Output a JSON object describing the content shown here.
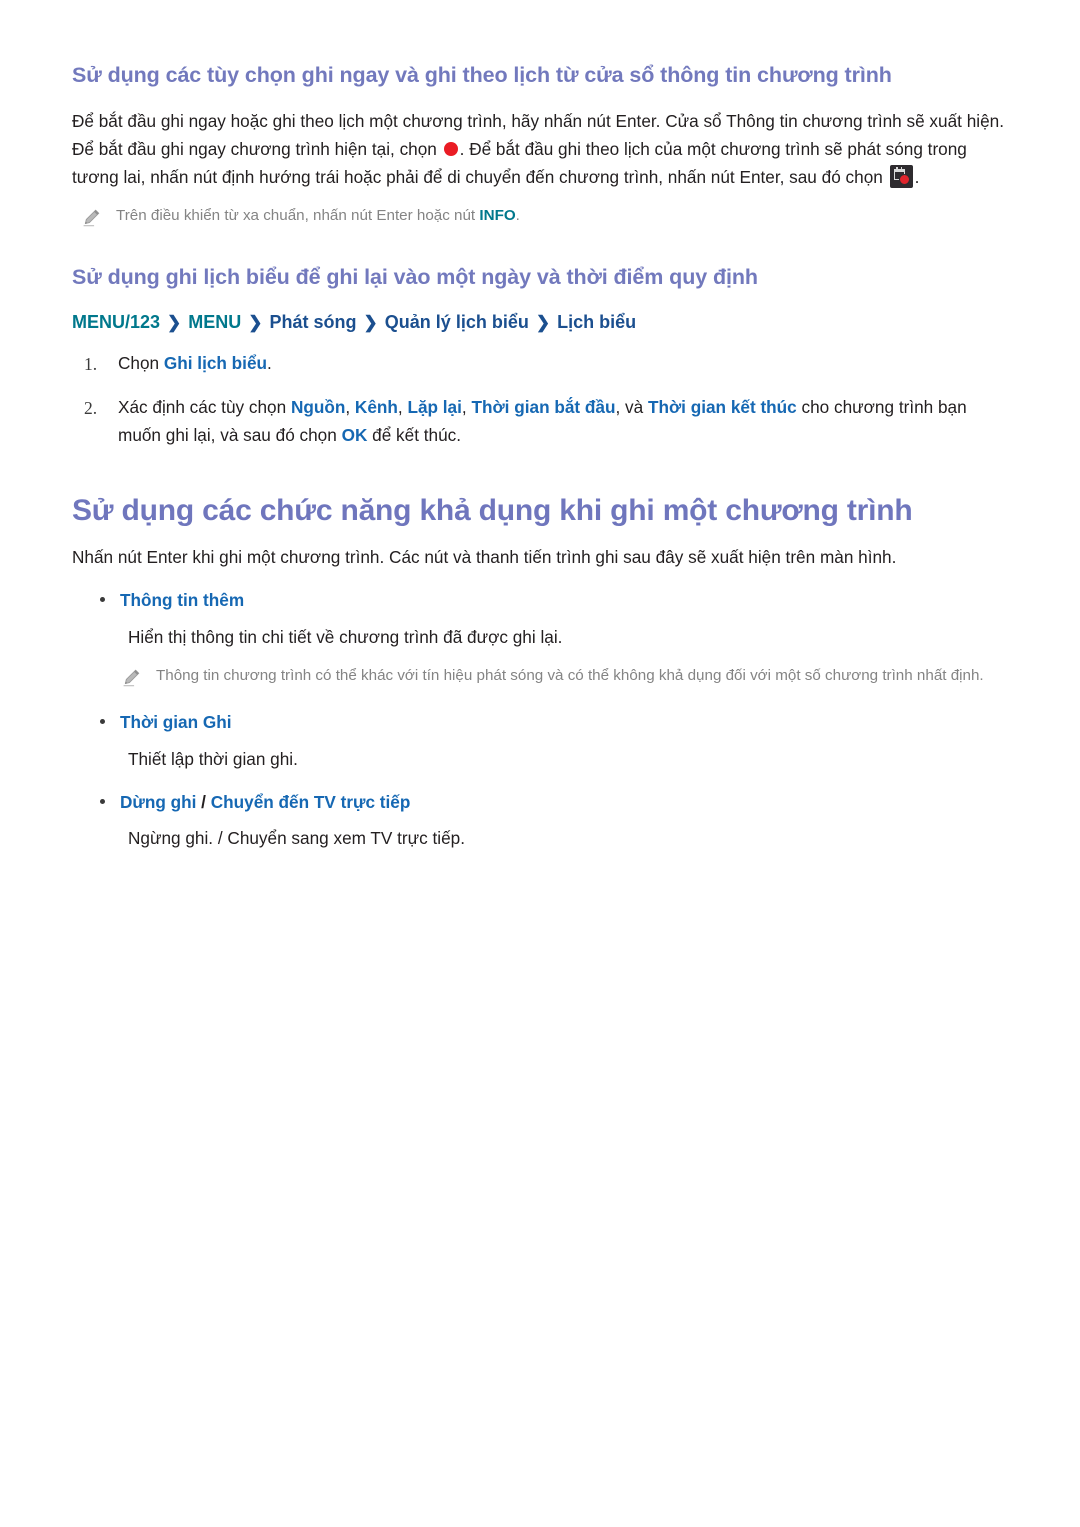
{
  "colors": {
    "heading_purple": "#7279bd",
    "link_blue": "#1668b3",
    "teal": "#00788c",
    "navy": "#1b4f8f",
    "body": "#231f20",
    "note_gray": "#848484",
    "record_red": "#ea1c24"
  },
  "section1": {
    "heading": "Sử dụng các tùy chọn ghi ngay và ghi theo lịch từ cửa sổ thông tin chương trình",
    "para_1": "Để bắt đầu ghi ngay hoặc ghi theo lịch một chương trình, hãy nhấn nút Enter. Cửa sổ Thông tin chương trình sẽ xuất hiện. Để bắt đầu ghi ngay chương trình hiện tại, chọn",
    "para_2": ". Để bắt đầu ghi theo lịch của một chương trình sẽ phát sóng trong tương lai, nhấn nút định hướng trái hoặc phải để di chuyển đến chương trình, nhấn nút Enter, sau đó chọn",
    "para_3": ".",
    "icon_record": "record-dot-icon",
    "icon_schedule": "schedule-record-icon",
    "note": {
      "icon": "pencil-icon",
      "text_before": "Trên điều khiển từ xa chuẩn, nhấn nút Enter hoặc nút ",
      "highlight": "INFO",
      "text_after": "."
    }
  },
  "section2": {
    "heading": "Sử dụng ghi lịch biểu để ghi lại vào một ngày và thời điểm quy định",
    "breadcrumb": [
      {
        "label": "MENU/123",
        "color": "teal"
      },
      {
        "label": "MENU",
        "color": "teal"
      },
      {
        "label": "Phát sóng",
        "color": "navy"
      },
      {
        "label": "Quản lý lịch biểu",
        "color": "navy"
      },
      {
        "label": "Lịch biểu",
        "color": "navy"
      }
    ],
    "breadcrumb_separator": "❯",
    "steps": [
      {
        "num": "1.",
        "parts": [
          {
            "t": "Chọn ",
            "s": "plain"
          },
          {
            "t": "Ghi lịch biểu",
            "s": "blue"
          },
          {
            "t": ".",
            "s": "plain"
          }
        ]
      },
      {
        "num": "2.",
        "parts": [
          {
            "t": "Xác định các tùy chọn ",
            "s": "plain"
          },
          {
            "t": "Nguồn",
            "s": "blue"
          },
          {
            "t": ", ",
            "s": "plain"
          },
          {
            "t": "Kênh",
            "s": "blue"
          },
          {
            "t": ", ",
            "s": "plain"
          },
          {
            "t": "Lặp lại",
            "s": "blue"
          },
          {
            "t": ", ",
            "s": "plain"
          },
          {
            "t": "Thời gian bắt đầu",
            "s": "blue"
          },
          {
            "t": ", và ",
            "s": "plain"
          },
          {
            "t": "Thời gian kết thúc",
            "s": "blue"
          },
          {
            "t": " cho chương trình bạn muốn ghi lại, và sau đó chọn ",
            "s": "plain"
          },
          {
            "t": "OK",
            "s": "blue"
          },
          {
            "t": " để kết thúc.",
            "s": "plain"
          }
        ]
      }
    ]
  },
  "section3": {
    "heading": "Sử dụng các chức năng khả dụng khi ghi một chương trình",
    "intro": "Nhấn nút Enter khi ghi một chương trình. Các nút và thanh tiến trình ghi sau đây sẽ xuất hiện trên màn hình.",
    "items": [
      {
        "label_parts": [
          {
            "t": "Thông tin thêm",
            "s": "blue"
          }
        ],
        "desc": "Hiển thị thông tin chi tiết về chương trình đã được ghi lại.",
        "note": {
          "icon": "pencil-icon",
          "text": "Thông tin chương trình có thể khác với tín hiệu phát sóng và có thể không khả dụng đối với một số chương trình nhất định."
        }
      },
      {
        "label_parts": [
          {
            "t": "Thời gian Ghi",
            "s": "blue"
          }
        ],
        "desc": "Thiết lập thời gian ghi.",
        "note": null
      },
      {
        "label_parts": [
          {
            "t": "Dừng ghi",
            "s": "blue"
          },
          {
            "t": " / ",
            "s": "slash"
          },
          {
            "t": "Chuyển đến TV trực tiếp",
            "s": "blue"
          }
        ],
        "desc": "Ngừng ghi. / Chuyển sang xem TV trực tiếp.",
        "note": null
      }
    ]
  }
}
